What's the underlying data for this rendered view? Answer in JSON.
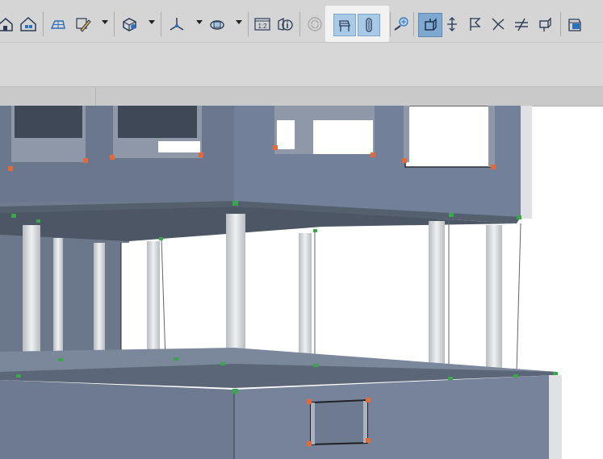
{
  "app": {
    "toolbar_icons": [
      "home-story-icon",
      "home-building-icon",
      "floor-plan-icon",
      "pencil-design-icon",
      "3d-box-icon",
      "axes-3d-icon",
      "orbit-icon",
      "layout-page-icon",
      "info-icon",
      "refresh-icon",
      "chair-object-icon",
      "column-object-icon",
      "zoom-add-icon",
      "select-box-icon",
      "move-vertical-icon",
      "flag-icon",
      "scatter-icon",
      "parallel-icon",
      "push-icon",
      "marker-icon"
    ],
    "layout_page_label": "1:2",
    "highlight_color": "#f2f2f2",
    "selected_color": "#7fa8d0"
  },
  "viewport": {
    "model": "3d-building-model",
    "wall_color": "#6f7c90",
    "floor_color": "#7b879a",
    "column_color": "#d6d9dc",
    "background": "#ffffff"
  }
}
